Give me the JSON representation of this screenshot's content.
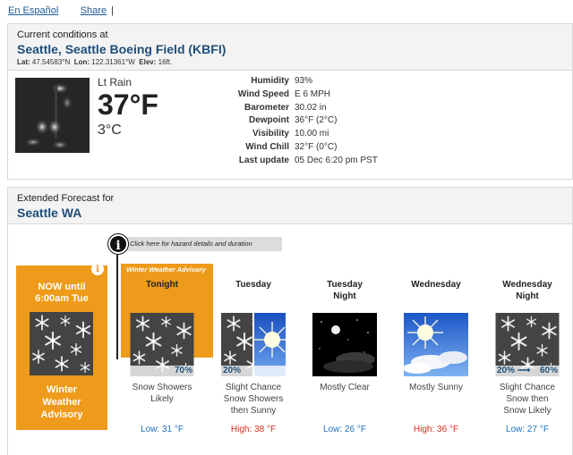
{
  "top_links": {
    "espanol": "En Español",
    "share": "Share",
    "sep": "|"
  },
  "current": {
    "label": "Current conditions at",
    "station": "Seattle, Seattle Boeing Field (KBFI)",
    "lat_label": "Lat:",
    "lat": "47.54583°N",
    "lon_label": "Lon:",
    "lon": "122.31361°W",
    "elev_label": "Elev:",
    "elev": "16ft.",
    "condition": "Lt Rain",
    "temp_f": "37°F",
    "temp_c": "3°C",
    "details": [
      {
        "k": "Humidity",
        "v": "93%"
      },
      {
        "k": "Wind Speed",
        "v": "E 6 MPH"
      },
      {
        "k": "Barometer",
        "v": "30.02 in"
      },
      {
        "k": "Dewpoint",
        "v": "36°F (2°C)"
      },
      {
        "k": "Visibility",
        "v": "10.00 mi"
      },
      {
        "k": "Wind Chill",
        "v": "32°F (0°C)"
      },
      {
        "k": "Last update",
        "v": "05 Dec 6:20 pm PST"
      }
    ]
  },
  "forecast": {
    "label": "Extended Forecast for",
    "location": "Seattle WA",
    "hazard_link": "Click here for hazard details and duration",
    "now_box": {
      "title": "NOW until\n6:00am Tue",
      "advisory": "Winter\nWeather\nAdvisory"
    },
    "advisory_tab": "Winter Weather Advisory",
    "periods": [
      {
        "name": "Tonight",
        "pct_left": "",
        "pct_right": "70%",
        "desc": "Snow Showers\nLikely",
        "temp": "Low: 31 °F",
        "kind": "lo",
        "icon": "snow"
      },
      {
        "name": "Tuesday",
        "pct_left": "20%",
        "pct_right": "",
        "desc": "Slight Chance\nSnow Showers\nthen Sunny",
        "temp": "High: 38 °F",
        "kind": "hi",
        "icon": "snow-sun"
      },
      {
        "name": "Tuesday\nNight",
        "pct_left": "",
        "pct_right": "",
        "desc": "Mostly Clear",
        "temp": "Low: 26 °F",
        "kind": "lo",
        "icon": "night"
      },
      {
        "name": "Wednesday",
        "pct_left": "",
        "pct_right": "",
        "desc": "Mostly Sunny",
        "temp": "High: 36 °F",
        "kind": "hi",
        "icon": "sunny"
      },
      {
        "name": "Wednesday\nNight",
        "pct_left": "20%",
        "pct_right": "60%",
        "pct_arrow": "⟶",
        "desc": "Slight Chance\nSnow then\nSnow Likely",
        "temp": "Low: 27 °F",
        "kind": "lo",
        "icon": "snow"
      }
    ]
  },
  "colors": {
    "advisory": "#ee9a1a",
    "link": "#1f5c99",
    "title": "#1f4e79",
    "low": "#1f6fbf",
    "high": "#d0301f"
  }
}
